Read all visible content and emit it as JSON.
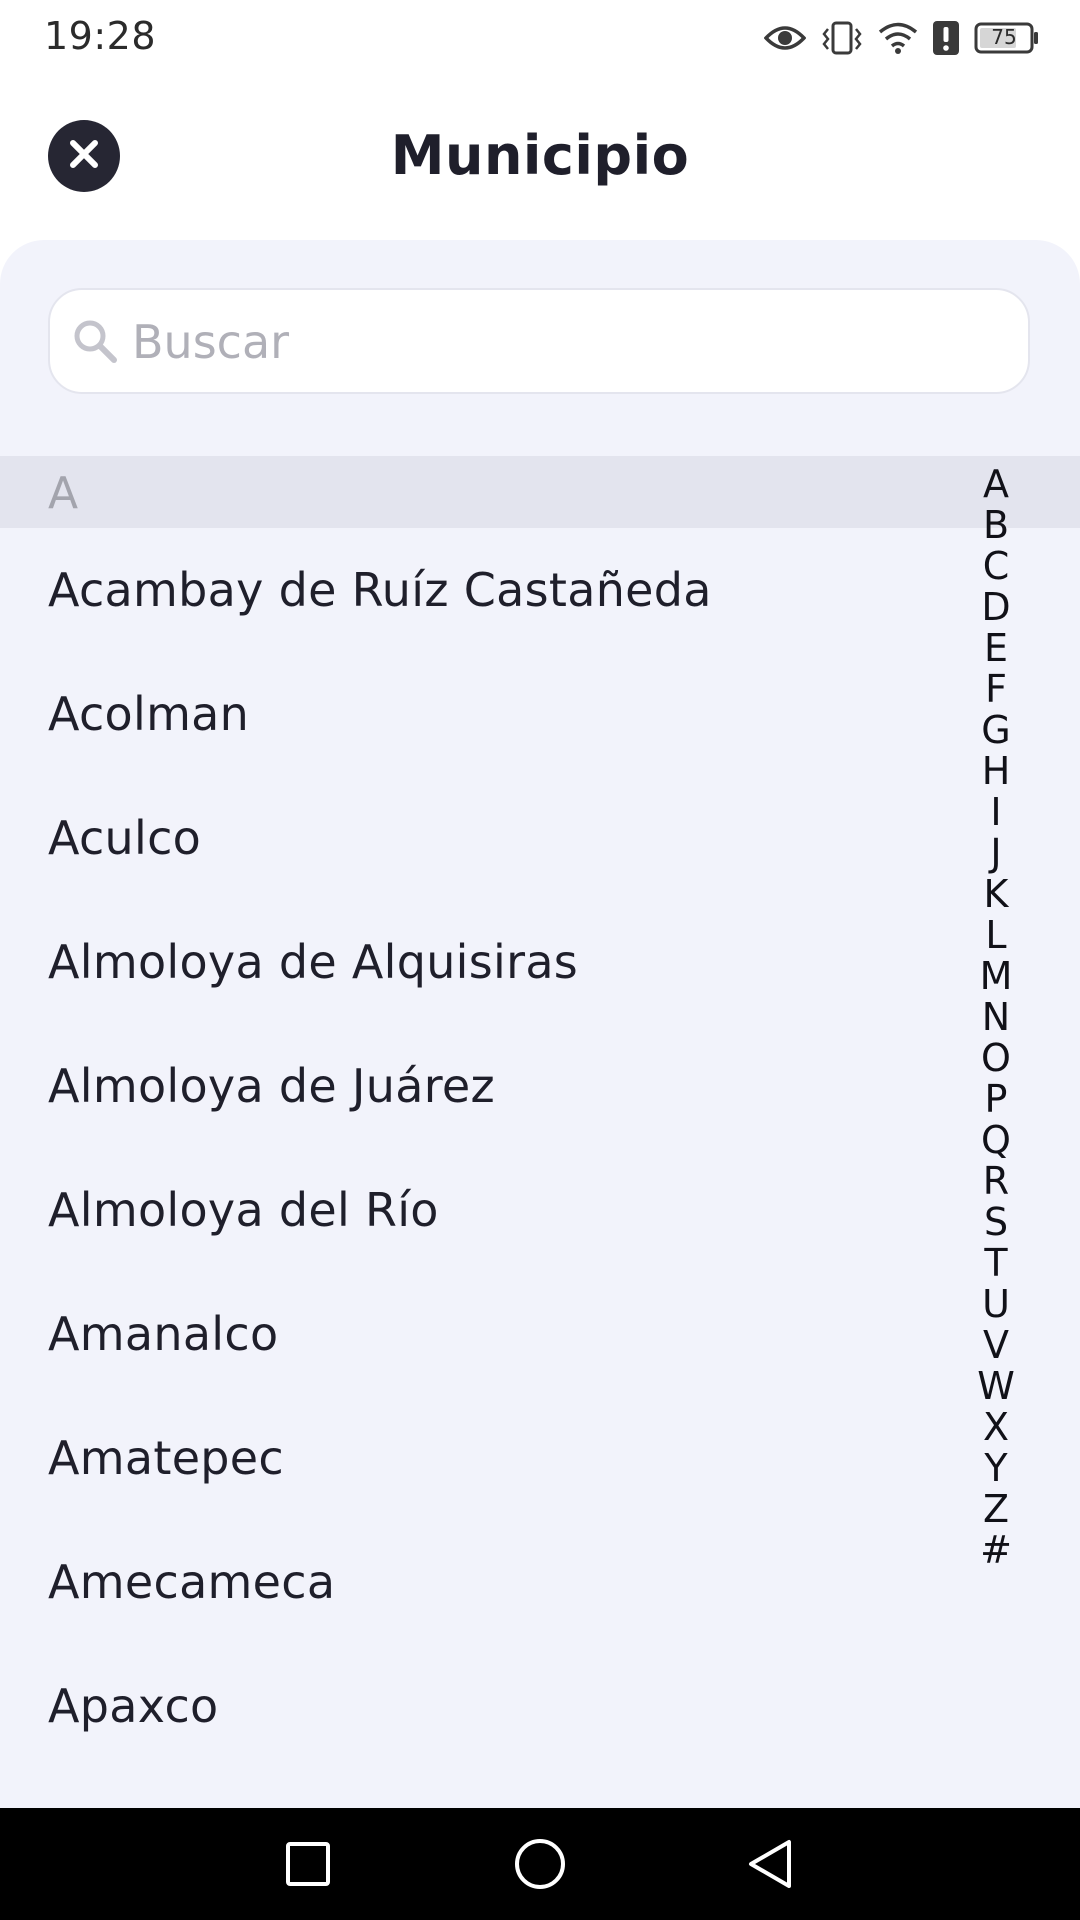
{
  "status_bar": {
    "time": "19:28",
    "battery": "75",
    "icons": [
      "eye-icon",
      "vibrate-icon",
      "wifi-icon",
      "alert-icon",
      "battery-icon"
    ]
  },
  "header": {
    "title": "Municipio",
    "close_icon": "close-icon"
  },
  "search": {
    "placeholder": "Buscar",
    "value": ""
  },
  "section": {
    "letter": "A"
  },
  "municipios": [
    "Acambay de Ruíz Castañeda",
    "Acolman",
    "Aculco",
    "Almoloya de Alquisiras",
    "Almoloya de Juárez",
    "Almoloya del Río",
    "Amanalco",
    "Amatepec",
    "Amecameca",
    "Apaxco"
  ],
  "alphabet": [
    "A",
    "B",
    "C",
    "D",
    "E",
    "F",
    "G",
    "H",
    "I",
    "J",
    "K",
    "L",
    "M",
    "N",
    "O",
    "P",
    "Q",
    "R",
    "S",
    "T",
    "U",
    "V",
    "W",
    "X",
    "Y",
    "Z",
    "#"
  ],
  "nav": {
    "icons": [
      "recents-square-icon",
      "home-circle-icon",
      "back-triangle-icon"
    ]
  },
  "colors": {
    "sheet_background": "#f2f3fb",
    "section_header": "#e3e4ee",
    "close_button": "#262633",
    "text": "#1f1f2b",
    "placeholder": "#b0b0b8"
  }
}
